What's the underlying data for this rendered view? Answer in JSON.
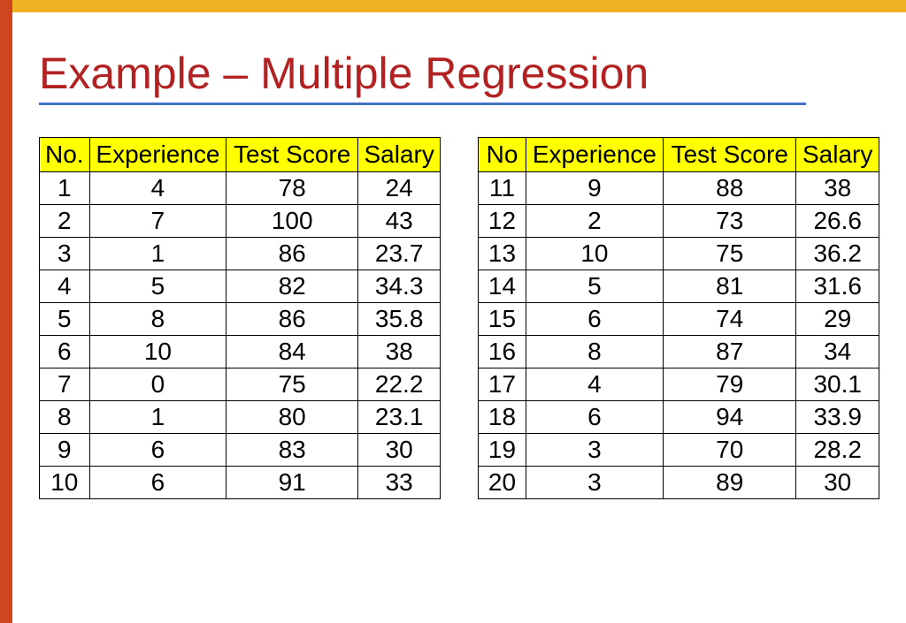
{
  "title": "Example – Multiple Regression",
  "table_left": {
    "headers": [
      "No.",
      "Experience",
      "Test Score",
      "Salary"
    ],
    "rows": [
      [
        "1",
        "4",
        "78",
        "24"
      ],
      [
        "2",
        "7",
        "100",
        "43"
      ],
      [
        "3",
        "1",
        "86",
        "23.7"
      ],
      [
        "4",
        "5",
        "82",
        "34.3"
      ],
      [
        "5",
        "8",
        "86",
        "35.8"
      ],
      [
        "6",
        "10",
        "84",
        "38"
      ],
      [
        "7",
        "0",
        "75",
        "22.2"
      ],
      [
        "8",
        "1",
        "80",
        "23.1"
      ],
      [
        "9",
        "6",
        "83",
        "30"
      ],
      [
        "10",
        "6",
        "91",
        "33"
      ]
    ]
  },
  "table_right": {
    "headers": [
      "No",
      "Experience",
      "Test Score",
      "Salary"
    ],
    "rows": [
      [
        "11",
        "9",
        "88",
        "38"
      ],
      [
        "12",
        "2",
        "73",
        "26.6"
      ],
      [
        "13",
        "10",
        "75",
        "36.2"
      ],
      [
        "14",
        "5",
        "81",
        "31.6"
      ],
      [
        "15",
        "6",
        "74",
        "29"
      ],
      [
        "16",
        "8",
        "87",
        "34"
      ],
      [
        "17",
        "4",
        "79",
        "30.1"
      ],
      [
        "18",
        "6",
        "94",
        "33.9"
      ],
      [
        "19",
        "3",
        "70",
        "28.2"
      ],
      [
        "20",
        "3",
        "89",
        "30"
      ]
    ]
  },
  "chart_data": {
    "type": "table",
    "title": "Example – Multiple Regression",
    "columns": [
      "No",
      "Experience",
      "Test Score",
      "Salary"
    ],
    "rows": [
      [
        1,
        4,
        78,
        24
      ],
      [
        2,
        7,
        100,
        43
      ],
      [
        3,
        1,
        86,
        23.7
      ],
      [
        4,
        5,
        82,
        34.3
      ],
      [
        5,
        8,
        86,
        35.8
      ],
      [
        6,
        10,
        84,
        38
      ],
      [
        7,
        0,
        75,
        22.2
      ],
      [
        8,
        1,
        80,
        23.1
      ],
      [
        9,
        6,
        83,
        30
      ],
      [
        10,
        6,
        91,
        33
      ],
      [
        11,
        9,
        88,
        38
      ],
      [
        12,
        2,
        73,
        26.6
      ],
      [
        13,
        10,
        75,
        36.2
      ],
      [
        14,
        5,
        81,
        31.6
      ],
      [
        15,
        6,
        74,
        29
      ],
      [
        16,
        8,
        87,
        34
      ],
      [
        17,
        4,
        79,
        30.1
      ],
      [
        18,
        6,
        94,
        33.9
      ],
      [
        19,
        3,
        70,
        28.2
      ],
      [
        20,
        3,
        89,
        30
      ]
    ]
  }
}
